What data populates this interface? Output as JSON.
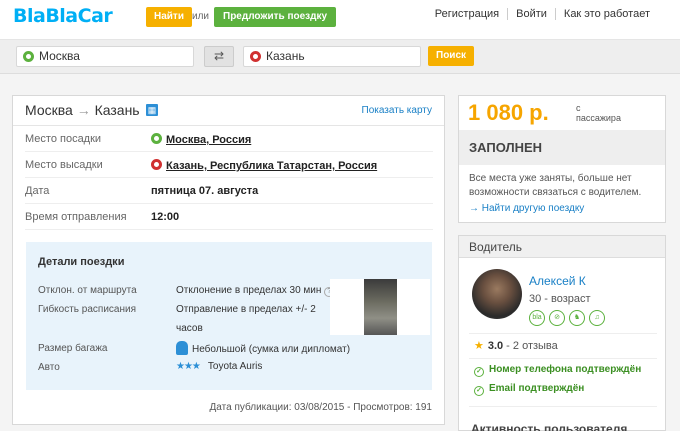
{
  "header": {
    "logo": "BlaBlaCar",
    "find_label": "Найти",
    "or_label": "или",
    "offer_label": "Предложить поездку",
    "nav": [
      "Регистрация",
      "Войти",
      "Как это работает"
    ]
  },
  "search": {
    "from": "Москва",
    "to": "Казань",
    "swap_icon": "swap-arrows-icon",
    "search_label": "Поиск"
  },
  "trip": {
    "from": "Москва",
    "arrow": "→",
    "to": "Казань",
    "show_map": "Показать карту",
    "rows": [
      {
        "label": "Место посадки",
        "value": "Москва, Россия"
      },
      {
        "label": "Место высадки",
        "value": "Казань, Республика Татарстан, Россия"
      },
      {
        "label": "Дата",
        "value": "пятница 07. августа"
      },
      {
        "label": "Время отправления",
        "value": "12:00"
      }
    ],
    "details": {
      "title": "Детали поездки",
      "deviation_label": "Отклон. от маршрута",
      "deviation_value": "Отклонение в пределах 30 мин",
      "flex_label": "Гибкость расписания",
      "flex_value_1": "Отправление в пределах +/- 2",
      "flex_value_2": "часов",
      "luggage_label": "Размер багажа",
      "luggage_value": "Небольшой (сумка или дипломат)",
      "car_label": "Авто",
      "car_stars": "★★★",
      "car_value": "Toyota Auris"
    },
    "published": "Дата публикации: 03/08/2015 - Просмотров: 191"
  },
  "price": {
    "amount": "1 080 р.",
    "per_1": "с",
    "per_2": "пассажира",
    "status": "ЗАПОЛНЕН",
    "message": "Все места уже заняты, больше нет возможности связаться с водителем.",
    "other_link": "→ Найти другую поездку"
  },
  "driver": {
    "heading": "Водитель",
    "name": "Алексей К",
    "age": "30 - возраст",
    "badges": [
      "bla-icon",
      "no-smoking-icon",
      "pet-icon",
      "music-icon"
    ],
    "rating_value": "3.0",
    "rating_count": "- 2 отзыва",
    "phone_verified": "Номер телефона подтверждён",
    "email_verified": "Email подтверждён",
    "activity": "Активность пользователя"
  },
  "colors": {
    "brand_blue": "#00aff5",
    "orange": "#f6b000",
    "green": "#5cb13e",
    "link": "#1a80c6"
  }
}
